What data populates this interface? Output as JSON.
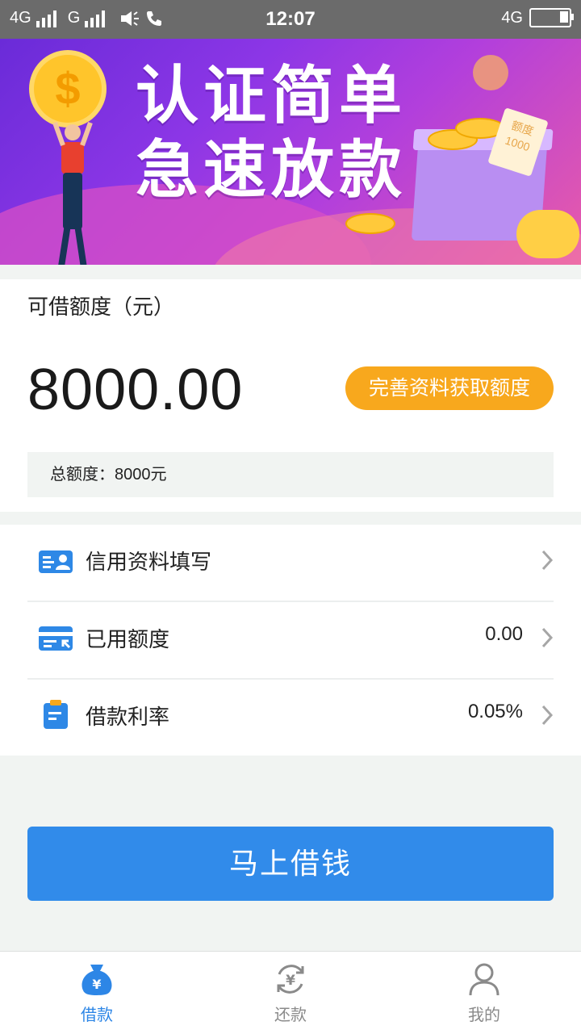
{
  "status_bar": {
    "network_left": "4G",
    "network_second": "G",
    "time": "12:07",
    "network_right": "4G"
  },
  "banner": {
    "headline_line1": "认证简单",
    "headline_line2": "急速放款",
    "coin_symbol": "$",
    "ticket_text_line1": "额度",
    "ticket_text_line2": "1000"
  },
  "quota": {
    "label": "可借额度（元）",
    "amount": "8000.00",
    "improve_button": "完善资料获取额度",
    "total_label": "总额度：8000元"
  },
  "menu": [
    {
      "label": "信用资料填写",
      "value": "",
      "icon": "id-card-icon"
    },
    {
      "label": "已用额度",
      "value": "0.00",
      "icon": "credit-card-icon"
    },
    {
      "label": "借款利率",
      "value": "0.05%",
      "icon": "clipboard-icon"
    }
  ],
  "borrow_button": "马上借钱",
  "tabs": [
    {
      "label": "借款",
      "icon": "money-bag-icon",
      "active": true
    },
    {
      "label": "还款",
      "icon": "repay-cycle-icon",
      "active": false
    },
    {
      "label": "我的",
      "icon": "user-icon",
      "active": false
    }
  ],
  "colors": {
    "accent_blue": "#318bea",
    "quota_orange": "#f8a81d",
    "tab_active": "#2d86e6",
    "tab_inactive": "#8a8a8a"
  }
}
